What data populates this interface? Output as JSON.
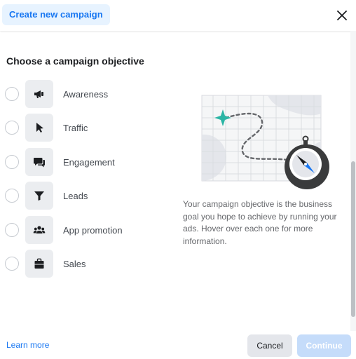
{
  "header": {
    "tab_label": "Create new campaign",
    "close_icon": "close-icon"
  },
  "main": {
    "title": "Choose a campaign objective",
    "objectives": [
      {
        "label": "Awareness",
        "icon": "megaphone-icon"
      },
      {
        "label": "Traffic",
        "icon": "cursor-icon"
      },
      {
        "label": "Engagement",
        "icon": "chat-bubbles-icon"
      },
      {
        "label": "Leads",
        "icon": "funnel-icon"
      },
      {
        "label": "App promotion",
        "icon": "people-icon"
      },
      {
        "label": "Sales",
        "icon": "shopping-bag-icon"
      }
    ],
    "description": "Your campaign objective is the business goal you hope to achieve by running your ads. Hover over each one for more information."
  },
  "footer": {
    "learn_more": "Learn more",
    "cancel": "Cancel",
    "continue": "Continue"
  },
  "colors": {
    "accent": "#1877f2",
    "accent_light": "#e7f3ff",
    "continue_disabled": "#c5dcfa",
    "map_marker": "#2bb5a5"
  }
}
